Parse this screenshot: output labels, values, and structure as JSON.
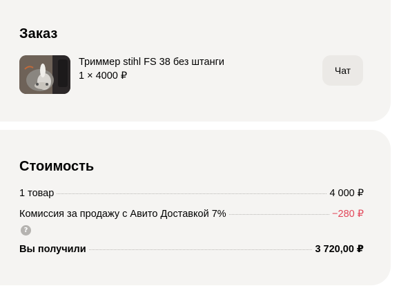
{
  "order": {
    "title": "Заказ",
    "item": {
      "name": "Триммер stihl FS 38 без штанги",
      "quantity_price": "1 × 4000 ₽",
      "thumbnail_icon": "product-photo"
    },
    "chat_label": "Чат"
  },
  "cost": {
    "title": "Стоимость",
    "rows": [
      {
        "label": "1 товар",
        "value": "4 000 ₽"
      },
      {
        "label": "Комиссия за продажу с Авито Доставкой 7%",
        "value": "−280 ₽"
      },
      {
        "label": "Вы получили",
        "value": "3 720,00 ₽"
      }
    ],
    "help_icon": "?"
  },
  "colors": {
    "card_bg": "#f5f4f2",
    "chat_button_bg": "#ebe9e6",
    "negative_value": "#e2475a",
    "help_icon_bg": "#b5b3b0"
  }
}
